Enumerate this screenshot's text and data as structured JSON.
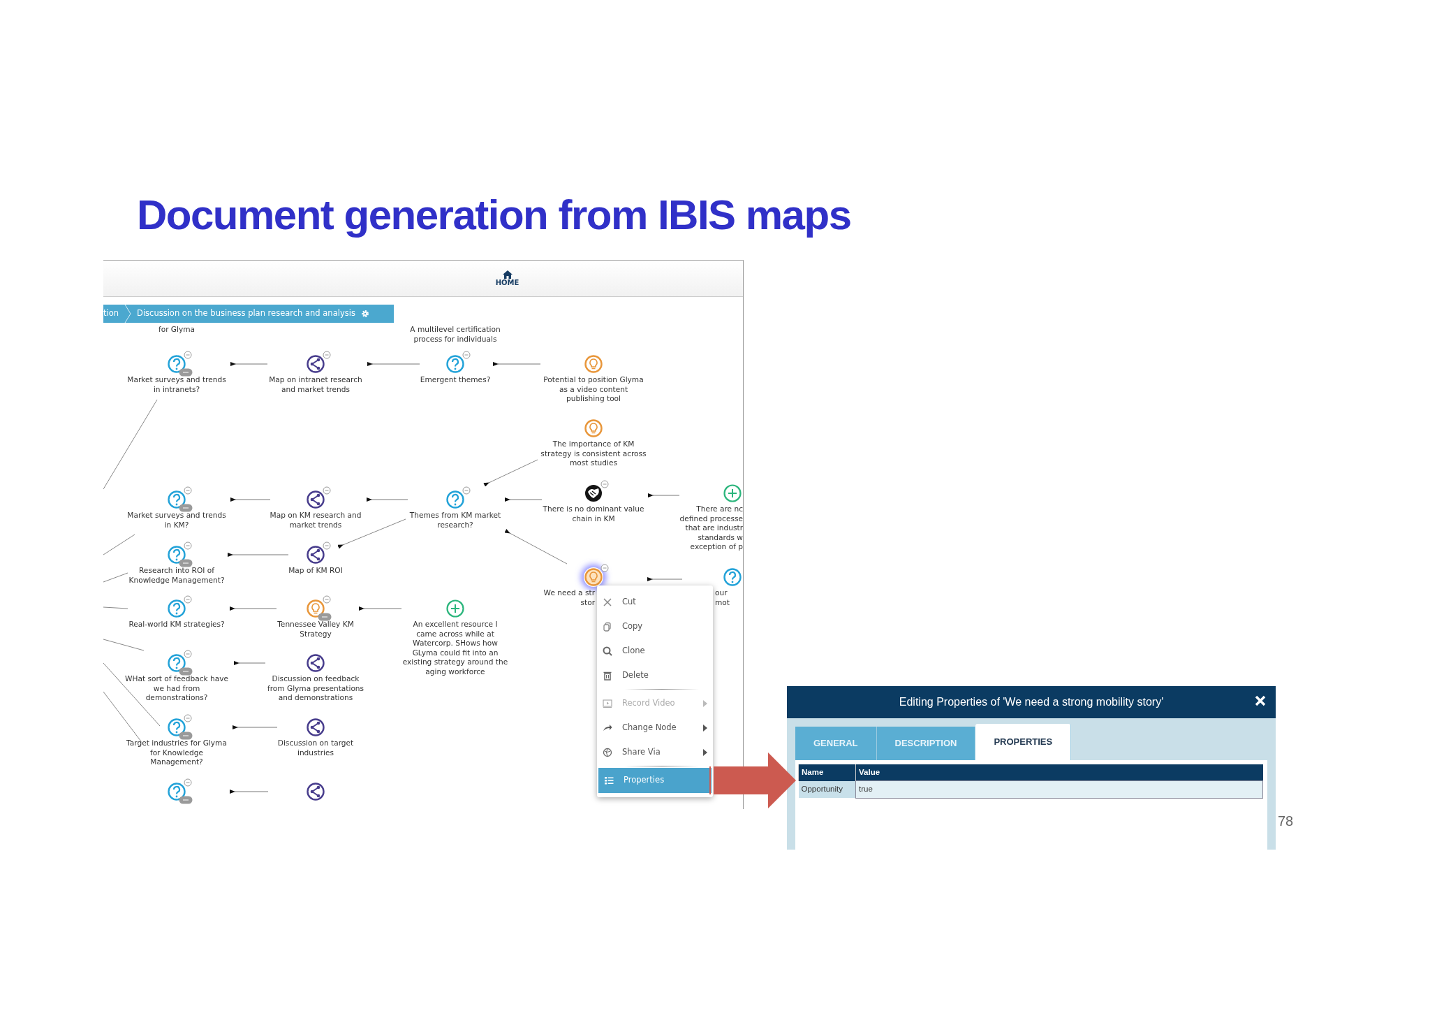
{
  "slide": {
    "title": "Document generation from IBIS maps",
    "page_number": "78"
  },
  "map": {
    "home_label": "HOME",
    "breadcrumb": [
      "tion",
      "Discussion on the business plan research and analysis"
    ],
    "nodes": [
      {
        "kind": "label",
        "label": "for Glyma"
      },
      {
        "kind": "label",
        "label": "A multilevel certification\nprocess for individuals"
      },
      {
        "kind": "question",
        "label": "Market surveys and trends\nin intranets?",
        "selected": false,
        "collapsible": true,
        "attachment": true
      },
      {
        "kind": "map",
        "label": "Map on intranet research\nand market trends",
        "selected": false,
        "collapsible": true,
        "attachment": false
      },
      {
        "kind": "question",
        "label": "Emergent themes?",
        "selected": false,
        "collapsible": true,
        "attachment": false
      },
      {
        "kind": "idea",
        "label": "Potential to position Glyma\nas a video content\npublishing tool",
        "selected": false,
        "collapsible": false,
        "attachment": false
      },
      {
        "kind": "idea",
        "label": "The importance of KM\nstrategy is consistent across\nmost studies",
        "selected": false,
        "collapsible": false,
        "attachment": false
      },
      {
        "kind": "con",
        "label": "There is no dominant value\nchain in KM",
        "selected": false,
        "collapsible": true,
        "attachment": false
      },
      {
        "kind": "pro",
        "label": "There are nc\ndefined processe\nthat are industr\nstandards w\nexception of p",
        "selected": false,
        "collapsible": false,
        "attachment": false
      },
      {
        "kind": "question",
        "label": "Market surveys and trends\nin KM?",
        "selected": false,
        "collapsible": true,
        "attachment": true
      },
      {
        "kind": "map",
        "label": "Map on KM research and\nmarket trends",
        "selected": false,
        "collapsible": true,
        "attachment": false
      },
      {
        "kind": "question",
        "label": "Themes from KM market\nresearch?",
        "selected": false,
        "collapsible": true,
        "attachment": false
      },
      {
        "kind": "question",
        "label": "Research into ROI of\nKnowledge Management?",
        "selected": false,
        "collapsible": true,
        "attachment": true
      },
      {
        "kind": "map",
        "label": "Map of KM ROI",
        "selected": false,
        "collapsible": true,
        "attachment": false
      },
      {
        "kind": "idea",
        "label": "We need a str\nstor",
        "selected": true,
        "collapsible": true,
        "attachment": false
      },
      {
        "kind": "question",
        "label": "our mot",
        "selected": false,
        "collapsible": false,
        "attachment": false
      },
      {
        "kind": "question",
        "label": "Real-world KM strategies?",
        "selected": false,
        "collapsible": true,
        "attachment": false
      },
      {
        "kind": "idea",
        "label": "Tennessee Valley KM\nStrategy",
        "selected": false,
        "collapsible": true,
        "attachment": true
      },
      {
        "kind": "pro",
        "label": "An excellent resource I\ncame across while at\nWatercorp. SHows how\nGLyma could fit into an\nexisting strategy around the\naging workforce",
        "selected": false,
        "collapsible": false,
        "attachment": false
      },
      {
        "kind": "question",
        "label": "WHat sort of feedback have\nwe had from\ndemonstrations?",
        "selected": false,
        "collapsible": true,
        "attachment": true
      },
      {
        "kind": "map",
        "label": "Discussion on feedback\nfrom Glyma presentations\nand demonstrations",
        "selected": false,
        "collapsible": false,
        "attachment": false
      },
      {
        "kind": "question",
        "label": "Target industries for Glyma\nfor Knowledge\nManagement?",
        "selected": false,
        "collapsible": true,
        "attachment": true
      },
      {
        "kind": "map",
        "label": "Discussion on target\nindustries",
        "selected": false,
        "collapsible": false,
        "attachment": false
      },
      {
        "kind": "question",
        "selected": false,
        "collapsible": true,
        "attachment": true
      },
      {
        "kind": "map",
        "selected": false,
        "collapsible": false,
        "attachment": false
      }
    ]
  },
  "context_menu": {
    "items": [
      {
        "kind": "item",
        "label": "Cut",
        "disabled": false,
        "submenu": false,
        "selected": false
      },
      {
        "kind": "item",
        "label": "Copy",
        "disabled": false,
        "submenu": false,
        "selected": false
      },
      {
        "kind": "item",
        "label": "Clone",
        "disabled": false,
        "submenu": false,
        "selected": false
      },
      {
        "kind": "item",
        "label": "Delete",
        "disabled": false,
        "submenu": false,
        "selected": false
      },
      {
        "kind": "separator"
      },
      {
        "kind": "item",
        "label": "Record Video",
        "disabled": true,
        "submenu": true,
        "selected": false
      },
      {
        "kind": "item",
        "label": "Change Node",
        "disabled": false,
        "submenu": true,
        "selected": false
      },
      {
        "kind": "item",
        "label": "Share Via",
        "disabled": false,
        "submenu": true,
        "selected": false
      },
      {
        "kind": "separator"
      },
      {
        "kind": "item",
        "label": "Properties",
        "disabled": false,
        "submenu": false,
        "selected": true
      }
    ]
  },
  "dialog": {
    "title": "Editing Properties of 'We need a strong mobility story'",
    "tabs": [
      {
        "label": "GENERAL",
        "selected": false
      },
      {
        "label": "DESCRIPTION",
        "selected": false
      },
      {
        "label": "PROPERTIES",
        "selected": true
      }
    ],
    "table": {
      "columns": [
        "Name",
        "Value"
      ],
      "rows": [
        [
          "Opportunity",
          "true"
        ]
      ]
    }
  }
}
